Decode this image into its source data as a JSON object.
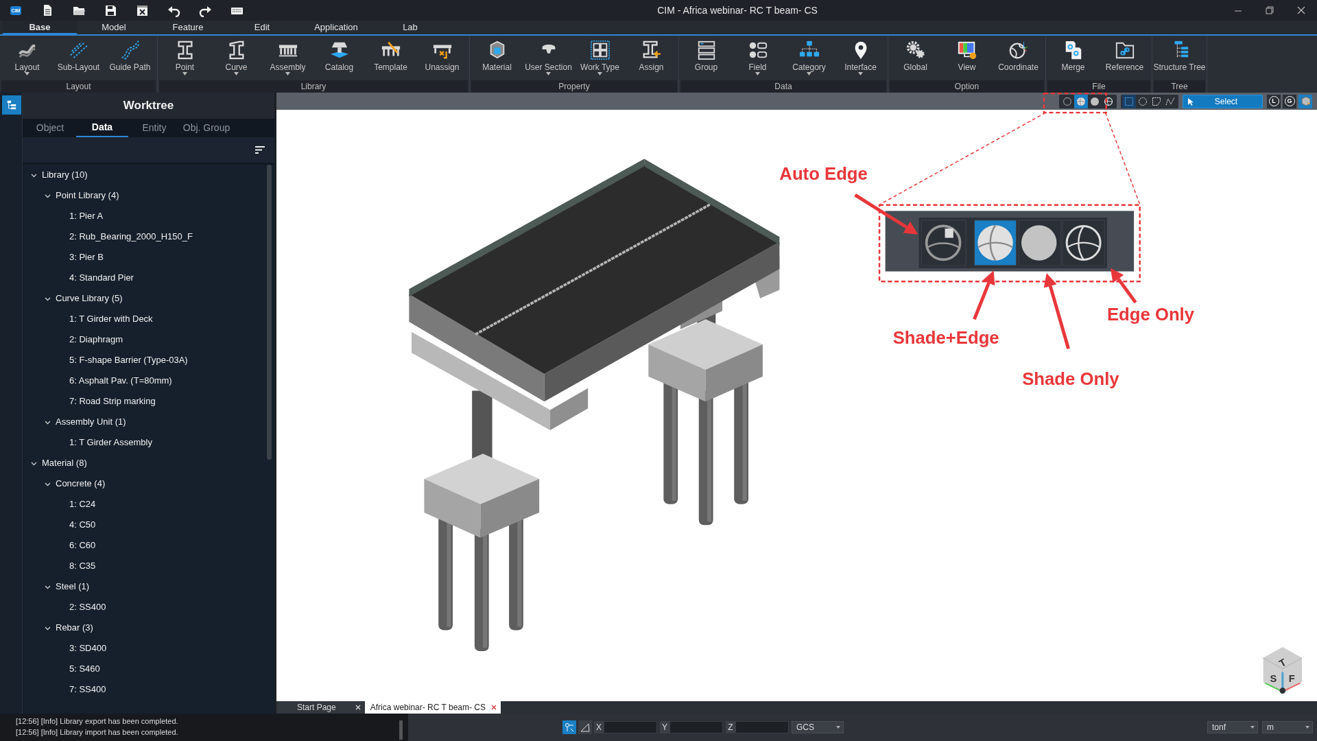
{
  "window": {
    "app_logo": "CIM",
    "title": "CIM - Africa webinar- RC T beam- CS"
  },
  "menu_tabs": [
    {
      "label": "Base",
      "selected": true
    },
    {
      "label": "Model",
      "selected": false
    },
    {
      "label": "Feature",
      "selected": false
    },
    {
      "label": "Edit",
      "selected": false
    },
    {
      "label": "Application",
      "selected": false
    },
    {
      "label": "Lab",
      "selected": false
    }
  ],
  "ribbon_groups": [
    {
      "label": "Layout",
      "buttons": [
        {
          "label": "Layout",
          "dropdown": true
        },
        {
          "label": "Sub-Layout",
          "dropdown": false
        },
        {
          "label": "Guide Path",
          "dropdown": false
        }
      ]
    },
    {
      "label": "Library",
      "buttons": [
        {
          "label": "Point",
          "dropdown": true
        },
        {
          "label": "Curve",
          "dropdown": true
        },
        {
          "label": "Assembly",
          "dropdown": true
        },
        {
          "label": "Catalog",
          "dropdown": false
        },
        {
          "label": "Template",
          "dropdown": false
        },
        {
          "label": "Unassign",
          "dropdown": false
        }
      ]
    },
    {
      "label": "Property",
      "buttons": [
        {
          "label": "Material",
          "dropdown": false
        },
        {
          "label": "User Section",
          "dropdown": true
        },
        {
          "label": "Work Type",
          "dropdown": true
        },
        {
          "label": "Assign",
          "dropdown": false
        }
      ]
    },
    {
      "label": "Data",
      "buttons": [
        {
          "label": "Group",
          "dropdown": false
        },
        {
          "label": "Field",
          "dropdown": true
        },
        {
          "label": "Category",
          "dropdown": true
        },
        {
          "label": "Interface",
          "dropdown": true
        }
      ]
    },
    {
      "label": "Option",
      "buttons": [
        {
          "label": "Global",
          "dropdown": false
        },
        {
          "label": "View",
          "dropdown": false
        },
        {
          "label": "Coordinate",
          "dropdown": false
        }
      ]
    },
    {
      "label": "File",
      "buttons": [
        {
          "label": "Merge",
          "dropdown": false
        },
        {
          "label": "Reference",
          "dropdown": false
        }
      ]
    },
    {
      "label": "Tree",
      "buttons": [
        {
          "label": "Structure Tree",
          "dropdown": false
        }
      ]
    }
  ],
  "worktree": {
    "title": "Worktree",
    "tabs": [
      {
        "label": "Object",
        "selected": false
      },
      {
        "label": "Data",
        "selected": true
      },
      {
        "label": "Entity",
        "selected": false
      },
      {
        "label": "Obj. Group",
        "selected": false
      }
    ],
    "tree": [
      {
        "label": "Library (10)",
        "expanded": true,
        "children": [
          {
            "label": "Point Library (4)",
            "expanded": true,
            "children": [
              {
                "label": "1: Pier A"
              },
              {
                "label": "2: Rub_Bearing_2000_H150_F"
              },
              {
                "label": "3: Pier B"
              },
              {
                "label": "4: Standard Pier"
              }
            ]
          },
          {
            "label": "Curve Library (5)",
            "expanded": true,
            "children": [
              {
                "label": "1: T Girder with Deck"
              },
              {
                "label": "2: Diaphragm"
              },
              {
                "label": "5: F-shape Barrier (Type-03A)"
              },
              {
                "label": "6: Asphalt Pav. (T=80mm)"
              },
              {
                "label": "7: Road Strip marking"
              }
            ]
          },
          {
            "label": "Assembly Unit (1)",
            "expanded": true,
            "children": [
              {
                "label": "1: T Girder Assembly"
              }
            ]
          }
        ]
      },
      {
        "label": "Material (8)",
        "expanded": true,
        "children": [
          {
            "label": "Concrete (4)",
            "expanded": true,
            "children": [
              {
                "label": "1: C24"
              },
              {
                "label": "4: C50"
              },
              {
                "label": "6: C60"
              },
              {
                "label": "8: C35"
              }
            ]
          },
          {
            "label": "Steel (1)",
            "expanded": true,
            "children": [
              {
                "label": "2: SS400"
              }
            ]
          },
          {
            "label": "Rebar (3)",
            "expanded": true,
            "children": [
              {
                "label": "3: SD400"
              },
              {
                "label": "5: S460"
              },
              {
                "label": "7: SS400"
              }
            ]
          }
        ]
      }
    ]
  },
  "view_toolbar": {
    "render_modes": [
      {
        "selected": false
      },
      {
        "selected": true
      },
      {
        "selected": false
      },
      {
        "selected": false
      }
    ],
    "selection_shapes": [
      {
        "selected": true
      },
      {
        "selected": false
      },
      {
        "selected": false
      },
      {
        "selected": false
      }
    ],
    "select_button": "Select",
    "toggles": [
      {
        "label": "L"
      },
      {
        "label": "G"
      }
    ],
    "cube_toggle": {
      "on": true
    }
  },
  "callout": {
    "buttons": [
      {
        "selected": false
      },
      {
        "selected": true
      },
      {
        "selected": false
      },
      {
        "selected": false
      }
    ],
    "labels": [
      "Auto Edge",
      "Shade+Edge",
      "Shade Only",
      "Edge Only"
    ]
  },
  "view_cube": {
    "faces": [
      "T",
      "S",
      "F"
    ]
  },
  "document_tabs": [
    {
      "label": "Start Page",
      "selected": false
    },
    {
      "label": "Africa webinar- RC T beam- CS",
      "selected": true
    }
  ],
  "status_bar": {
    "log": [
      "[12:56] [Info] Library export has been completed.",
      "[12:56] [Info] Library import has been completed."
    ],
    "coordinates": [
      {
        "label": "X"
      },
      {
        "label": "Y"
      },
      {
        "label": "Z"
      }
    ],
    "coord_system": "GCS",
    "units": [
      "tonf",
      "m"
    ]
  }
}
